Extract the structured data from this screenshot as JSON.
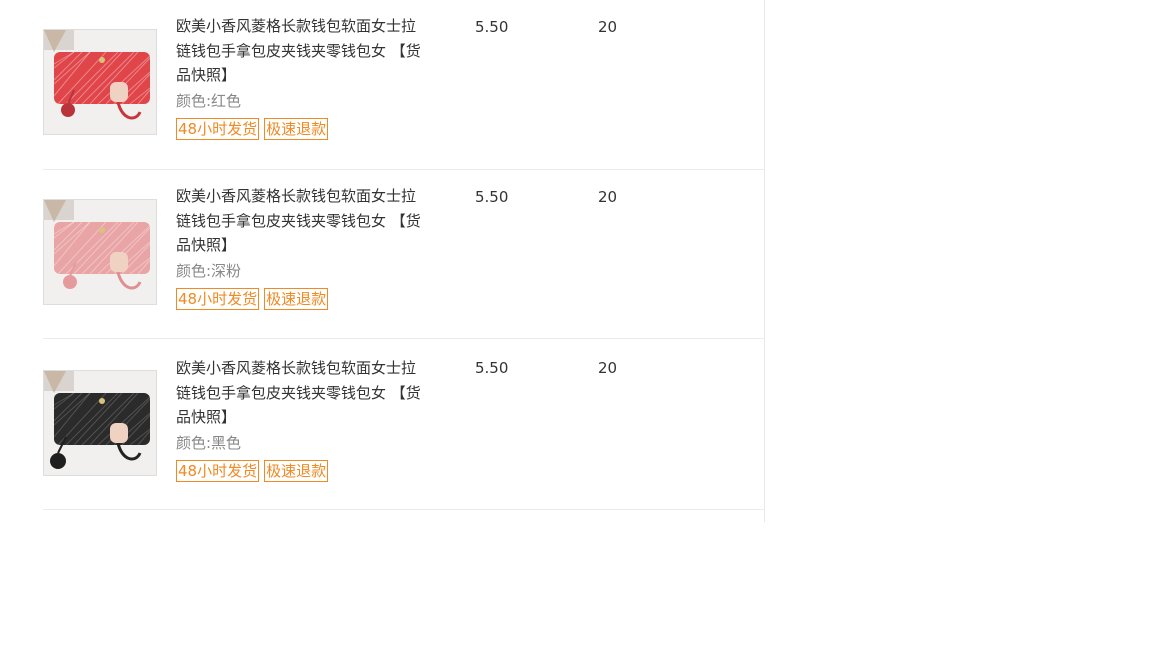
{
  "items": [
    {
      "title": "欧美小香风菱格长款钱包软面女士拉链钱包手拿包皮夹钱夹零钱包女 【货品快照】",
      "color_label": "颜色:红色",
      "price": "5.50",
      "quantity": "20",
      "tags": [
        "48小时发货",
        "极速退款"
      ],
      "wallet_color": "#e0454a"
    },
    {
      "title": "欧美小香风菱格长款钱包软面女士拉链钱包手拿包皮夹钱夹零钱包女 【货品快照】",
      "color_label": "颜色:深粉",
      "price": "5.50",
      "quantity": "20",
      "tags": [
        "48小时发货",
        "极速退款"
      ],
      "wallet_color": "#e9a4a6"
    },
    {
      "title": "欧美小香风菱格长款钱包软面女士拉链钱包手拿包皮夹钱夹零钱包女 【货品快照】",
      "color_label": "颜色:黑色",
      "price": "5.50",
      "quantity": "20",
      "tags": [
        "48小时发货",
        "极速退款"
      ],
      "wallet_color": "#2b2b2b"
    }
  ]
}
